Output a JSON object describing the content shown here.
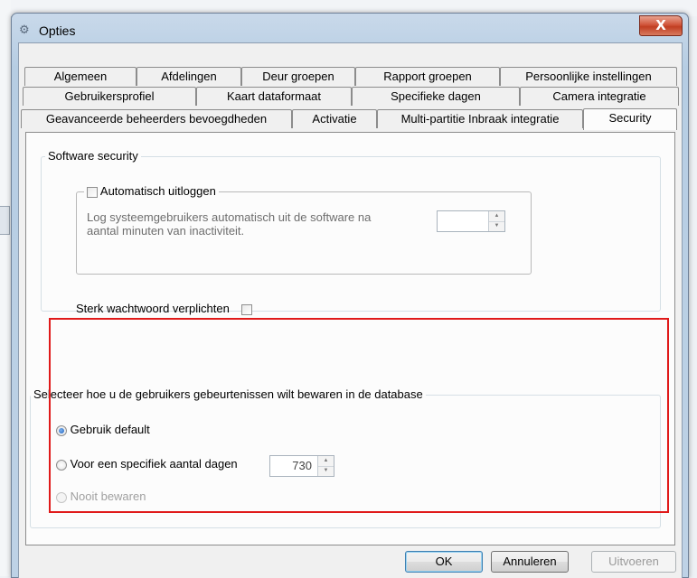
{
  "window": {
    "title": "Opties",
    "close_label": "X"
  },
  "tabs_row1": [
    "Algemeen",
    "Afdelingen",
    "Deur groepen",
    "Rapport groepen",
    "Persoonlijke instellingen"
  ],
  "tabs_row2": [
    "Gebruikersprofiel",
    "Kaart dataformaat",
    "Specifieke dagen",
    "Camera integratie"
  ],
  "tabs_row3": [
    "Geavanceerde beheerders bevoegdheden",
    "Activatie",
    "Multi-partitie Inbraak integratie",
    "Security"
  ],
  "active_tab": "Security",
  "software_security": {
    "legend": "Software security",
    "auto_logout": {
      "label": "Automatisch uitloggen",
      "checked": false,
      "description": "Log systeemgebruikers automatisch uit de software  na aantal minuten van inactiviteit.",
      "minutes_value": ""
    },
    "strong_password": {
      "label": "Sterk wachtwoord verplichten",
      "checked": false
    }
  },
  "event_storage": {
    "legend": "Selecteer hoe u de gebruikers gebeurtenissen wilt bewaren in de database",
    "options": [
      {
        "label": "Gebruik default",
        "checked": true,
        "enabled": true
      },
      {
        "label": "Voor een specifiek aantal dagen",
        "checked": false,
        "enabled": true
      },
      {
        "label": "Nooit bewaren",
        "checked": false,
        "enabled": false
      }
    ],
    "days_value": "730"
  },
  "buttons": {
    "ok": "OK",
    "cancel": "Annuleren",
    "apply": "Uitvoeren"
  },
  "colors": {
    "highlight_border": "#e01a1a",
    "title_bar": "#c2d5e9",
    "close_button": "#c94a30"
  },
  "icons": {
    "title_icon": "settings-gear-icon",
    "spin_up": "arrow-up-icon",
    "spin_down": "arrow-down-icon"
  }
}
